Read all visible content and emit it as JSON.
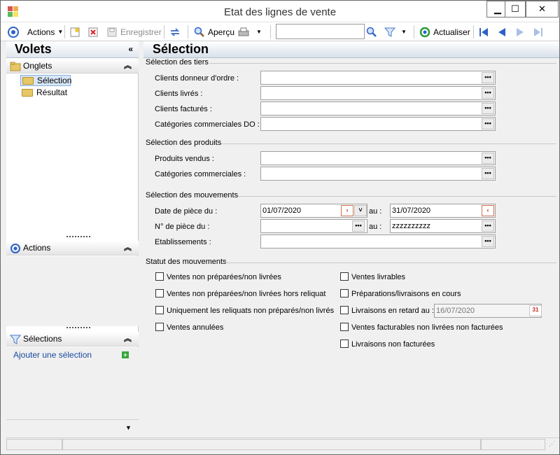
{
  "window": {
    "title": "Etat des lignes de vente"
  },
  "toolbar": {
    "actions_label": "Actions",
    "save_label": "Enregistrer",
    "preview_label": "Aperçu",
    "refresh_label": "Actualiser",
    "search_value": ""
  },
  "left": {
    "header": "Volets",
    "onglets": {
      "title": "Onglets",
      "items": [
        "Sélection",
        "Résultat"
      ]
    },
    "actions": {
      "title": "Actions"
    },
    "selections": {
      "title": "Sélections",
      "add_link": "Ajouter une sélection"
    }
  },
  "main": {
    "header": "Sélection",
    "tiers": {
      "title": "Sélection des tiers",
      "fields": [
        {
          "label": "Clients donneur d'ordre :",
          "value": ""
        },
        {
          "label": "Clients livrés :",
          "value": ""
        },
        {
          "label": "Clients facturés :",
          "value": ""
        },
        {
          "label": "Catégories commerciales DO :",
          "value": ""
        }
      ]
    },
    "produits": {
      "title": "Sélection des produits",
      "fields": [
        {
          "label": "Produits vendus :",
          "value": ""
        },
        {
          "label": "Catégories commerciales :",
          "value": ""
        }
      ]
    },
    "mouvements": {
      "title": "Sélection des mouvements",
      "date_label": "Date de pièce du :",
      "date_from": "01/07/2020",
      "au_label": "au :",
      "date_to": "31/07/2020",
      "piece_label": "N° de pièce du :",
      "piece_from": "",
      "piece_to": "zzzzzzzzzz",
      "etab_label": "Etablissements :",
      "etab_value": ""
    },
    "statut": {
      "title": "Statut des mouvements",
      "left_checks": [
        "Ventes non préparées/non livrées",
        "Ventes non préparées/non livrées hors reliquat",
        "Uniquement les reliquats non préparés/non livrés",
        "Ventes annulées"
      ],
      "right_checks": [
        "Ventes livrables",
        "Préparations/livraisons en cours",
        "Livraisons en retard au :",
        "Ventes facturables non livrées non facturées",
        "Livraisons non facturées"
      ],
      "late_date": "16/07/2020"
    }
  },
  "colors": {
    "accent": "#2f62c8",
    "header_gradient_end": "#d8e0ea"
  }
}
